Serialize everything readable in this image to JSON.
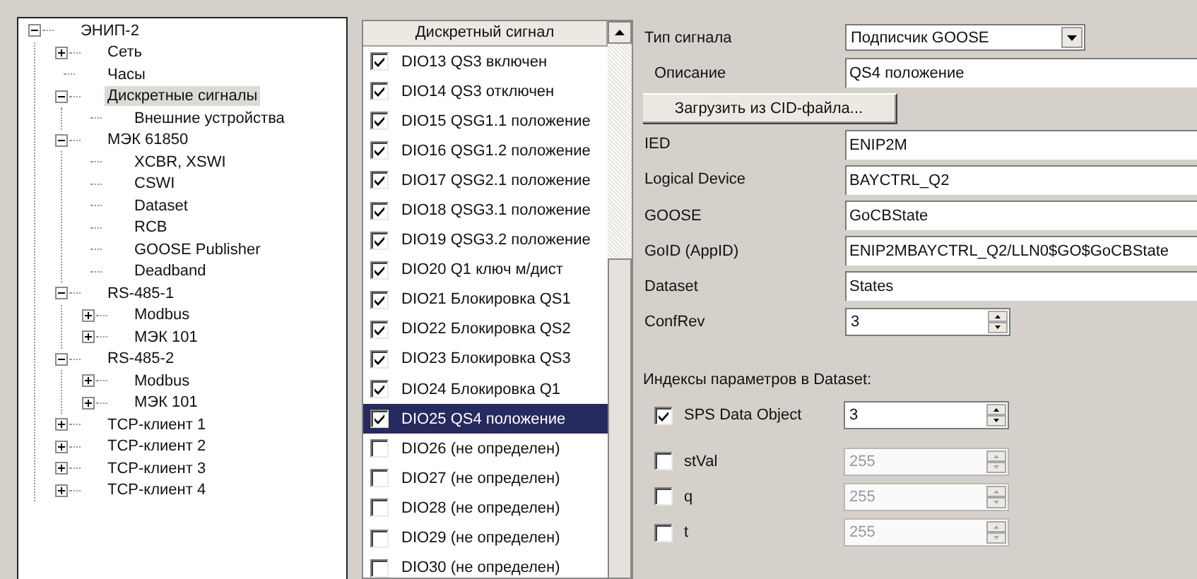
{
  "tree": [
    {
      "label": "ЭНИП-2",
      "expanded": true,
      "selected": false,
      "children": [
        {
          "label": "Сеть",
          "expanded": false,
          "selected": false
        },
        {
          "label": "Часы",
          "selected": false
        },
        {
          "label": "Дискретные сигналы",
          "expanded": true,
          "selected": true,
          "children": [
            {
              "label": "Внешние устройства",
              "selected": false
            }
          ]
        },
        {
          "label": "МЭК 61850",
          "expanded": true,
          "selected": false,
          "children": [
            {
              "label": "XCBR, XSWI",
              "selected": false
            },
            {
              "label": "CSWI",
              "selected": false
            },
            {
              "label": "Dataset",
              "selected": false
            },
            {
              "label": "RCB",
              "selected": false
            },
            {
              "label": "GOOSE Publisher",
              "selected": false
            },
            {
              "label": "Deadband",
              "selected": false
            }
          ]
        },
        {
          "label": "RS-485-1",
          "expanded": true,
          "selected": false,
          "children": [
            {
              "label": "Modbus",
              "expanded": false,
              "selected": false
            },
            {
              "label": "МЭК 101",
              "expanded": false,
              "selected": false
            }
          ]
        },
        {
          "label": "RS-485-2",
          "expanded": true,
          "selected": false,
          "children": [
            {
              "label": "Modbus",
              "expanded": false,
              "selected": false
            },
            {
              "label": "МЭК 101",
              "expanded": false,
              "selected": false
            }
          ]
        },
        {
          "label": "TCP-клиент 1",
          "expanded": false,
          "selected": false
        },
        {
          "label": "TCP-клиент 2",
          "expanded": false,
          "selected": false
        },
        {
          "label": "TCP-клиент 3",
          "expanded": false,
          "selected": false
        },
        {
          "label": "TCP-клиент 4",
          "expanded": false,
          "selected": false
        }
      ]
    }
  ],
  "signals": {
    "header": "Дискретный сигнал",
    "rows": [
      {
        "label": "DIO13 QS3 включен",
        "checked": true,
        "selected": false
      },
      {
        "label": "DIO14 QS3 отключен",
        "checked": true,
        "selected": false
      },
      {
        "label": "DIO15 QSG1.1 положение",
        "checked": true,
        "selected": false
      },
      {
        "label": "DIO16 QSG1.2 положение",
        "checked": true,
        "selected": false
      },
      {
        "label": "DIO17 QSG2.1 положение",
        "checked": true,
        "selected": false
      },
      {
        "label": "DIO18 QSG3.1 положение",
        "checked": true,
        "selected": false
      },
      {
        "label": "DIO19 QSG3.2 положение",
        "checked": true,
        "selected": false
      },
      {
        "label": "DIO20 Q1 ключ м/дист",
        "checked": true,
        "selected": false
      },
      {
        "label": "DIO21 Блокировка QS1",
        "checked": true,
        "selected": false
      },
      {
        "label": "DIO22 Блокировка QS2",
        "checked": true,
        "selected": false
      },
      {
        "label": "DIO23 Блокировка QS3",
        "checked": true,
        "selected": false
      },
      {
        "label": "DIO24 Блокировка Q1",
        "checked": true,
        "selected": false
      },
      {
        "label": "DIO25 QS4 положение",
        "checked": true,
        "selected": true
      },
      {
        "label": "DIO26 (не определен)",
        "checked": false,
        "selected": false
      },
      {
        "label": "DIO27 (не определен)",
        "checked": false,
        "selected": false
      },
      {
        "label": "DIO28 (не определен)",
        "checked": false,
        "selected": false
      },
      {
        "label": "DIO29 (не определен)",
        "checked": false,
        "selected": false
      },
      {
        "label": "DIO30 (не определен)",
        "checked": false,
        "selected": false
      }
    ]
  },
  "form": {
    "rows": [
      {
        "kind": "combo",
        "label": "Тип сигнала",
        "value": "Подписчик GOOSE"
      },
      {
        "kind": "subfield",
        "label": "Описание",
        "value": "QS4 положение"
      },
      {
        "kind": "button",
        "label": "Загрузить из CID-файла..."
      },
      {
        "kind": "text",
        "label": "IED",
        "value": "ENIP2M"
      },
      {
        "kind": "text",
        "label": "Logical Device",
        "value": "BAYCTRL_Q2"
      },
      {
        "kind": "text",
        "label": "GOOSE",
        "value": "GoCBState"
      },
      {
        "kind": "text",
        "label": "GoID (AppID)",
        "value": "ENIP2MBAYCTRL_Q2/LLN0$GO$GoCBState"
      },
      {
        "kind": "text",
        "label": "Dataset",
        "value": "States"
      },
      {
        "kind": "spin",
        "label": "ConfRev",
        "value": "3"
      },
      {
        "kind": "heading",
        "label": "Индексы параметров в Dataset:"
      },
      {
        "kind": "check_spin",
        "label": "SPS Data Object",
        "value": "3",
        "checked": true
      },
      {
        "kind": "check_spin",
        "label": "stVal",
        "value": "255",
        "checked": false
      },
      {
        "kind": "check_spin",
        "label": "q",
        "value": "255",
        "checked": false
      },
      {
        "kind": "check_spin",
        "label": "t",
        "value": "255",
        "checked": false
      }
    ]
  }
}
